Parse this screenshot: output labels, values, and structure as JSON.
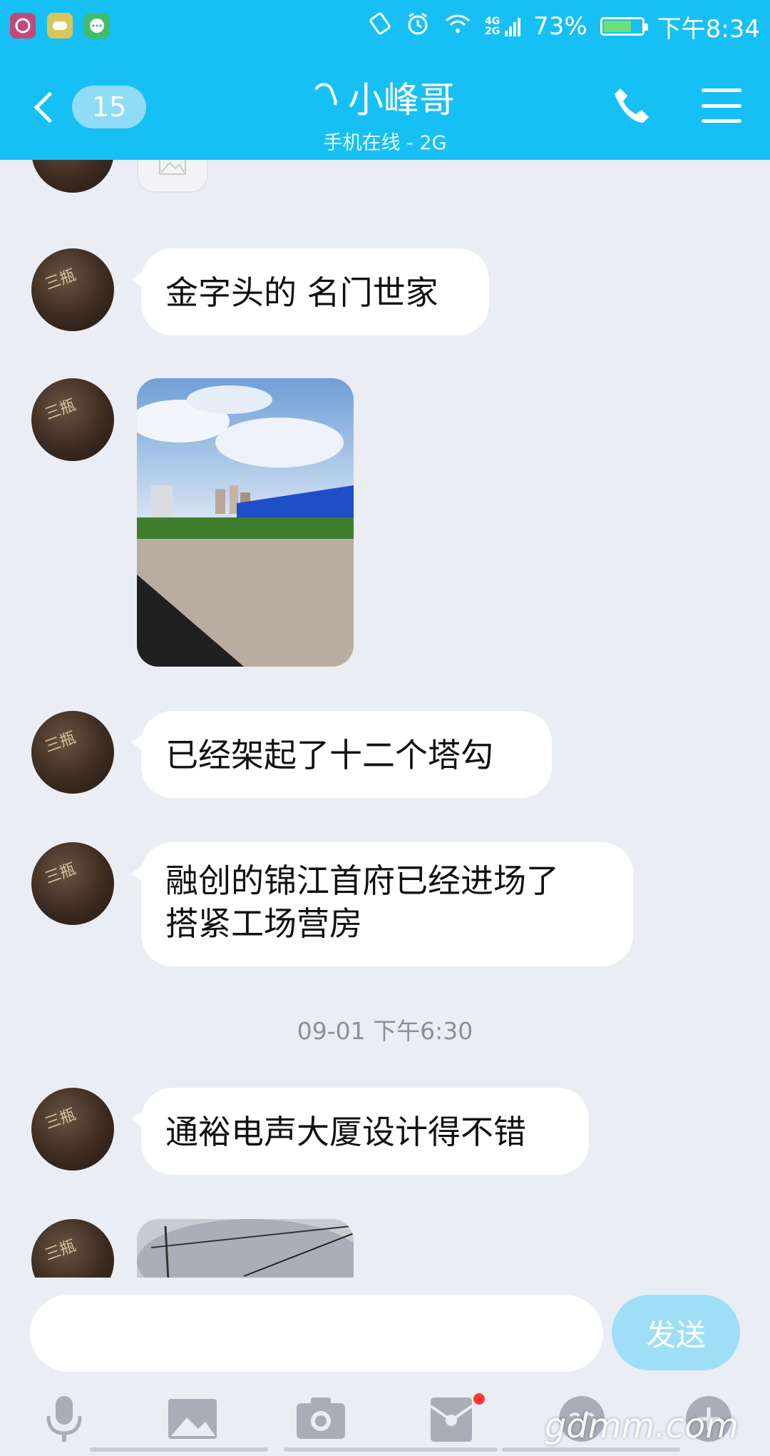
{
  "status_bar": {
    "network": "4G 2G",
    "battery": "73%",
    "battery_level": 0.73,
    "time": "下午8:34"
  },
  "header": {
    "back_badge": "15",
    "title": "小峰哥",
    "subtitle": "手机在线 - 2G"
  },
  "messages": [
    {
      "type": "text",
      "text": "金字头的 名门世家"
    },
    {
      "type": "image"
    },
    {
      "type": "text",
      "text": "已经架起了十二个塔勾"
    },
    {
      "type": "text",
      "lines": [
        "融创的锦江首府已经进场了",
        "搭紧工场营房"
      ]
    },
    {
      "type": "timestamp",
      "text": "09-01 下午6:30"
    },
    {
      "type": "text",
      "text": "通裕电声大厦设计得不错"
    },
    {
      "type": "image"
    }
  ],
  "input": {
    "value": "",
    "send_label": "发送"
  },
  "toolbar": {
    "items": [
      "microphone-icon",
      "image-icon",
      "camera-icon",
      "red-packet-icon",
      "emoji-icon",
      "plus-icon"
    ]
  },
  "watermark": "gdmm.com",
  "colors": {
    "header_bg": "#17c0f4",
    "chat_bg": "#eaedf4",
    "send_bg": "#9edff6",
    "badge_bg": "#8fdcf6"
  }
}
